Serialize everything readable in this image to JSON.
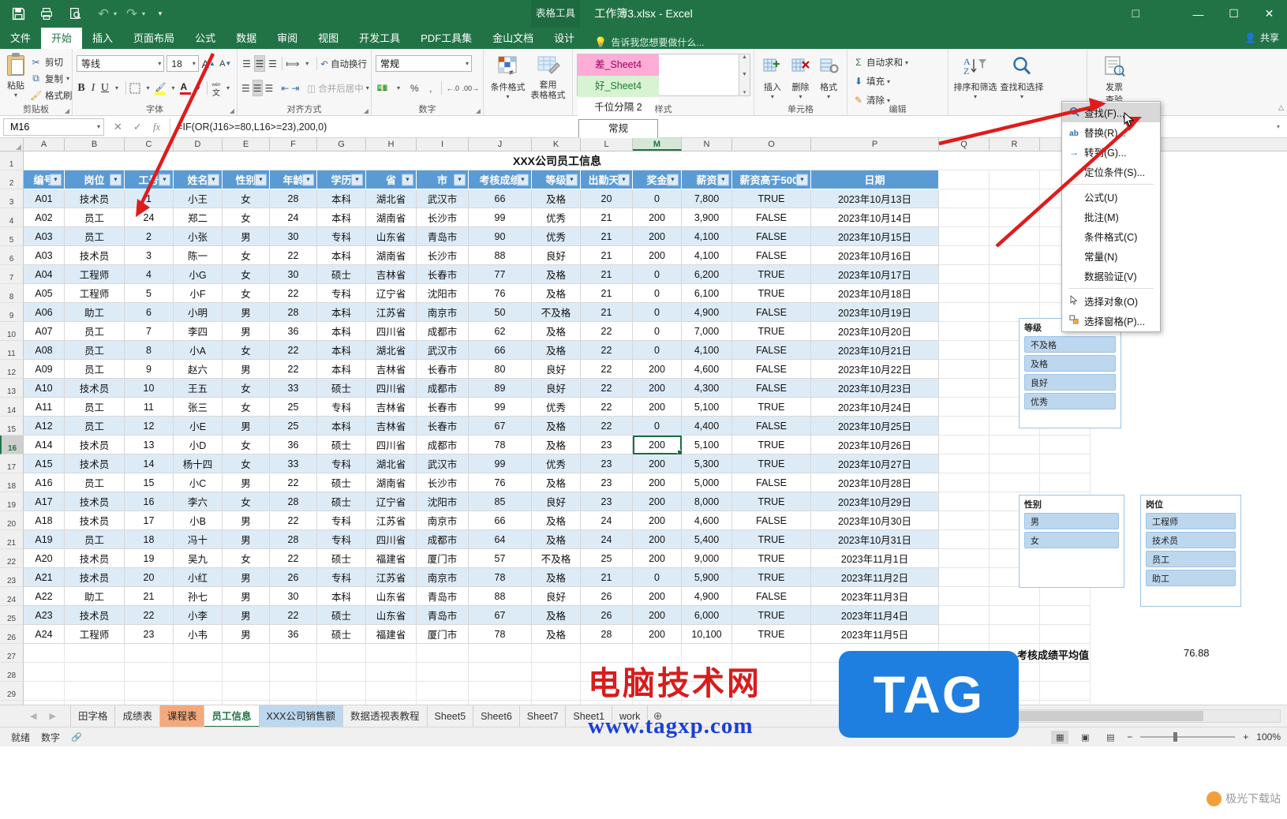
{
  "titlebar": {
    "qat": [
      {
        "name": "save-button",
        "glyph": "ὋE"
      },
      {
        "name": "quick-print-button",
        "glyph": "print"
      },
      {
        "name": "print-preview-button",
        "glyph": "preview"
      },
      {
        "name": "undo-button",
        "glyph": "↶"
      },
      {
        "name": "redo-button",
        "glyph": "↷"
      },
      {
        "name": "customize-qat-button",
        "glyph": "▾"
      }
    ],
    "app_title": "工作簿3.xlsx - Excel",
    "context_tool": "表格工具",
    "minimize": "—",
    "maximize": "☐",
    "close": "✕"
  },
  "ribbon_tabs": [
    {
      "label": "文件",
      "active": false
    },
    {
      "label": "开始",
      "active": true
    },
    {
      "label": "插入",
      "active": false
    },
    {
      "label": "页面布局",
      "active": false
    },
    {
      "label": "公式",
      "active": false
    },
    {
      "label": "数据",
      "active": false
    },
    {
      "label": "审阅",
      "active": false
    },
    {
      "label": "视图",
      "active": false
    },
    {
      "label": "开发工具",
      "active": false
    },
    {
      "label": "PDF工具集",
      "active": false
    },
    {
      "label": "金山文档",
      "active": false
    },
    {
      "label": "设计",
      "active": false
    }
  ],
  "tell_me": "告诉我您想要做什么...",
  "share_label": "共享",
  "ribbon": {
    "clipboard": {
      "group_label": "剪贴板",
      "paste_label": "粘贴",
      "cut_label": "剪切",
      "copy_label": "复制",
      "format_painter_label": "格式刷"
    },
    "font": {
      "group_label": "字体",
      "font_name": "等线",
      "font_size": "18",
      "grow_label": "A",
      "shrink_label": "A",
      "bold_label": "B",
      "italic_label": "I",
      "underline_label": "U",
      "phonetic_label": "文"
    },
    "alignment": {
      "group_label": "对齐方式",
      "wrap_label": "自动换行",
      "merge_label": "合并后居中"
    },
    "number": {
      "group_label": "数字",
      "format_value": "常规",
      "percent_label": "%",
      "comma_label": ",",
      "inc_dec_label": ".0",
      "dec_dec_label": ".00"
    },
    "styles": {
      "group_label": "样式",
      "conditional_label": "条件格式",
      "table_format_label": "套用\n表格格式",
      "cell_styles": [
        {
          "label": "差_Sheet4",
          "kind": "bad"
        },
        {
          "label": "好_Sheet4",
          "kind": "good"
        },
        {
          "label": "千位分隔 2",
          "kind": "plain"
        },
        {
          "label": "常规",
          "kind": "sel"
        }
      ]
    },
    "cells": {
      "group_label": "单元格",
      "insert_label": "插入",
      "delete_label": "删除",
      "format_label": "格式"
    },
    "editing": {
      "group_label": "编辑",
      "autosum_label": "自动求和",
      "fill_label": "填充",
      "clear_label": "清除",
      "sort_filter_label": "排序和筛选",
      "find_select_label": "查找和选择"
    },
    "invoice": {
      "line1": "发票",
      "line2": "查验"
    }
  },
  "find_menu": {
    "items": [
      {
        "label": "查找(F)...",
        "icon": "magnifier-icon",
        "highlighted": true,
        "sep_after": false
      },
      {
        "label": "替换(R)...",
        "icon": "replace-icon",
        "highlighted": false,
        "sep_after": false
      },
      {
        "label": "转到(G)...",
        "icon": "goto-arrow-icon",
        "highlighted": false,
        "sep_after": false
      },
      {
        "label": "定位条件(S)...",
        "icon": "",
        "highlighted": false,
        "sep_after": true
      },
      {
        "label": "公式(U)",
        "icon": "",
        "highlighted": false,
        "sep_after": false
      },
      {
        "label": "批注(M)",
        "icon": "",
        "highlighted": false,
        "sep_after": false
      },
      {
        "label": "条件格式(C)",
        "icon": "",
        "highlighted": false,
        "sep_after": false
      },
      {
        "label": "常量(N)",
        "icon": "",
        "highlighted": false,
        "sep_after": false
      },
      {
        "label": "数据验证(V)",
        "icon": "",
        "highlighted": false,
        "sep_after": true
      },
      {
        "label": "选择对象(O)",
        "icon": "pointer-icon",
        "highlighted": false,
        "sep_after": false
      },
      {
        "label": "选择窗格(P)...",
        "icon": "selection-pane-icon",
        "highlighted": false,
        "sep_after": false
      }
    ]
  },
  "formula_bar": {
    "name_box": "M16",
    "cancel_icon": "✕",
    "confirm_icon": "✓",
    "fx_icon": "fx",
    "formula": "=IF(OR(J16>=80,L16>=23),200,0)"
  },
  "grid": {
    "columns": [
      "A",
      "B",
      "C",
      "D",
      "E",
      "F",
      "G",
      "H",
      "I",
      "J",
      "K",
      "L",
      "M",
      "N",
      "O",
      "P",
      "Q",
      "R",
      "S"
    ],
    "selected_column": "M",
    "selected_row": "16",
    "sheet_title": "XXX公司员工信息",
    "table_headers": [
      "编号",
      "岗位",
      "工号",
      "姓名",
      "性别",
      "年龄",
      "学历",
      "省",
      "市",
      "考核成绩",
      "等级",
      "出勤天数",
      "奖金",
      "薪资",
      "薪资高于5000",
      "日期"
    ],
    "rows": [
      [
        "A01",
        "技术员",
        "1",
        "小王",
        "女",
        "28",
        "本科",
        "湖北省",
        "武汉市",
        "66",
        "及格",
        "20",
        "0",
        "7,800",
        "TRUE",
        "2023年10月13日"
      ],
      [
        "A02",
        "员工",
        "24",
        "郑二",
        "女",
        "24",
        "本科",
        "湖南省",
        "长沙市",
        "99",
        "优秀",
        "21",
        "200",
        "3,900",
        "FALSE",
        "2023年10月14日"
      ],
      [
        "A03",
        "员工",
        "2",
        "小张",
        "男",
        "30",
        "专科",
        "山东省",
        "青岛市",
        "90",
        "优秀",
        "21",
        "200",
        "4,100",
        "FALSE",
        "2023年10月15日"
      ],
      [
        "A03",
        "技术员",
        "3",
        "陈一",
        "女",
        "22",
        "本科",
        "湖南省",
        "长沙市",
        "88",
        "良好",
        "21",
        "200",
        "4,100",
        "FALSE",
        "2023年10月16日"
      ],
      [
        "A04",
        "工程师",
        "4",
        "小G",
        "女",
        "30",
        "硕士",
        "吉林省",
        "长春市",
        "77",
        "及格",
        "21",
        "0",
        "6,200",
        "TRUE",
        "2023年10月17日"
      ],
      [
        "A05",
        "工程师",
        "5",
        "小F",
        "女",
        "22",
        "专科",
        "辽宁省",
        "沈阳市",
        "76",
        "及格",
        "21",
        "0",
        "6,100",
        "TRUE",
        "2023年10月18日"
      ],
      [
        "A06",
        "助工",
        "6",
        "小明",
        "男",
        "28",
        "本科",
        "江苏省",
        "南京市",
        "50",
        "不及格",
        "21",
        "0",
        "4,900",
        "FALSE",
        "2023年10月19日"
      ],
      [
        "A07",
        "员工",
        "7",
        "李四",
        "男",
        "36",
        "本科",
        "四川省",
        "成都市",
        "62",
        "及格",
        "22",
        "0",
        "7,000",
        "TRUE",
        "2023年10月20日"
      ],
      [
        "A08",
        "员工",
        "8",
        "小A",
        "女",
        "22",
        "本科",
        "湖北省",
        "武汉市",
        "66",
        "及格",
        "22",
        "0",
        "4,100",
        "FALSE",
        "2023年10月21日"
      ],
      [
        "A09",
        "员工",
        "9",
        "赵六",
        "男",
        "22",
        "本科",
        "吉林省",
        "长春市",
        "80",
        "良好",
        "22",
        "200",
        "4,600",
        "FALSE",
        "2023年10月22日"
      ],
      [
        "A10",
        "技术员",
        "10",
        "王五",
        "女",
        "33",
        "硕士",
        "四川省",
        "成都市",
        "89",
        "良好",
        "22",
        "200",
        "4,300",
        "FALSE",
        "2023年10月23日"
      ],
      [
        "A11",
        "员工",
        "11",
        "张三",
        "女",
        "25",
        "专科",
        "吉林省",
        "长春市",
        "99",
        "优秀",
        "22",
        "200",
        "5,100",
        "TRUE",
        "2023年10月24日"
      ],
      [
        "A12",
        "员工",
        "12",
        "小E",
        "男",
        "25",
        "本科",
        "吉林省",
        "长春市",
        "67",
        "及格",
        "22",
        "0",
        "4,400",
        "FALSE",
        "2023年10月25日"
      ],
      [
        "A14",
        "技术员",
        "13",
        "小D",
        "女",
        "36",
        "硕士",
        "四川省",
        "成都市",
        "78",
        "及格",
        "23",
        "200",
        "5,100",
        "TRUE",
        "2023年10月26日"
      ],
      [
        "A15",
        "技术员",
        "14",
        "杨十四",
        "女",
        "33",
        "专科",
        "湖北省",
        "武汉市",
        "99",
        "优秀",
        "23",
        "200",
        "5,300",
        "TRUE",
        "2023年10月27日"
      ],
      [
        "A16",
        "员工",
        "15",
        "小C",
        "男",
        "22",
        "硕士",
        "湖南省",
        "长沙市",
        "76",
        "及格",
        "23",
        "200",
        "5,000",
        "FALSE",
        "2023年10月28日"
      ],
      [
        "A17",
        "技术员",
        "16",
        "李六",
        "女",
        "28",
        "硕士",
        "辽宁省",
        "沈阳市",
        "85",
        "良好",
        "23",
        "200",
        "8,000",
        "TRUE",
        "2023年10月29日"
      ],
      [
        "A18",
        "技术员",
        "17",
        "小B",
        "男",
        "22",
        "专科",
        "江苏省",
        "南京市",
        "66",
        "及格",
        "24",
        "200",
        "4,600",
        "FALSE",
        "2023年10月30日"
      ],
      [
        "A19",
        "员工",
        "18",
        "冯十",
        "男",
        "28",
        "专科",
        "四川省",
        "成都市",
        "64",
        "及格",
        "24",
        "200",
        "5,400",
        "TRUE",
        "2023年10月31日"
      ],
      [
        "A20",
        "技术员",
        "19",
        "吴九",
        "女",
        "22",
        "硕士",
        "福建省",
        "厦门市",
        "57",
        "不及格",
        "25",
        "200",
        "9,000",
        "TRUE",
        "2023年11月1日"
      ],
      [
        "A21",
        "技术员",
        "20",
        "小红",
        "男",
        "26",
        "专科",
        "江苏省",
        "南京市",
        "78",
        "及格",
        "21",
        "0",
        "5,900",
        "TRUE",
        "2023年11月2日"
      ],
      [
        "A22",
        "助工",
        "21",
        "孙七",
        "男",
        "30",
        "本科",
        "山东省",
        "青岛市",
        "88",
        "良好",
        "26",
        "200",
        "4,900",
        "FALSE",
        "2023年11月3日"
      ],
      [
        "A23",
        "技术员",
        "22",
        "小李",
        "男",
        "22",
        "硕士",
        "山东省",
        "青岛市",
        "67",
        "及格",
        "26",
        "200",
        "6,000",
        "TRUE",
        "2023年11月4日"
      ],
      [
        "A24",
        "工程师",
        "23",
        "小韦",
        "男",
        "36",
        "硕士",
        "福建省",
        "厦门市",
        "78",
        "及格",
        "28",
        "200",
        "10,100",
        "TRUE",
        "2023年11月5日"
      ]
    ],
    "selected_cell_value": "200"
  },
  "slicers": [
    {
      "name": "grade",
      "title": "等级",
      "items": [
        "不及格",
        "及格",
        "良好",
        "优秀"
      ]
    },
    {
      "name": "gender",
      "title": "性别",
      "items": [
        "男",
        "女"
      ]
    },
    {
      "name": "position",
      "title": "岗位",
      "items": [
        "工程师",
        "技术员",
        "员工",
        "助工"
      ]
    }
  ],
  "summary": {
    "label": "考核成绩平均值",
    "value": "76.88"
  },
  "sheet_tabs": [
    {
      "label": "田字格",
      "state": "normal"
    },
    {
      "label": "成绩表",
      "state": "normal"
    },
    {
      "label": "课程表",
      "state": "orange"
    },
    {
      "label": "员工信息",
      "state": "active"
    },
    {
      "label": "XXX公司销售额",
      "state": "blue"
    },
    {
      "label": "数据透视表教程",
      "state": "normal"
    },
    {
      "label": "Sheet5",
      "state": "normal"
    },
    {
      "label": "Sheet6",
      "state": "normal"
    },
    {
      "label": "Sheet7",
      "state": "normal"
    },
    {
      "label": "Sheet1",
      "state": "normal"
    },
    {
      "label": "work",
      "state": "normal"
    }
  ],
  "add_sheet_label": "⊕",
  "status_bar": {
    "ready": "就绪",
    "mode": "数字",
    "zoom": "100%",
    "views": [
      "normal-view",
      "page-layout-view",
      "page-break-view"
    ]
  },
  "watermarks": {
    "line1": "电脑技术网",
    "line2": "www.tagxp.com",
    "tag": "TAG",
    "corner": "极光下载站"
  },
  "colors": {
    "excel_green": "#217346",
    "table_header_blue": "#5b9bd5",
    "band_blue": "#ddebf7",
    "arrow_red": "#e01b1b",
    "accent_select": "#1e6b41"
  }
}
